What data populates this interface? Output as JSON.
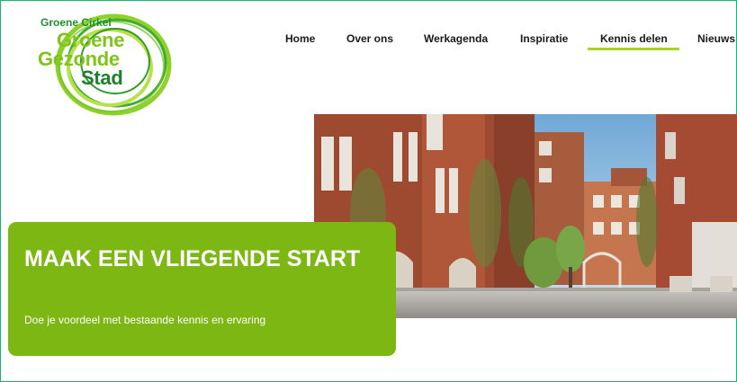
{
  "logo": {
    "top_text": "Groene Cirkel",
    "line1": "Groene",
    "line2": "Gezonde",
    "line3": "Stad"
  },
  "nav": {
    "items": [
      {
        "label": "Home"
      },
      {
        "label": "Over ons"
      },
      {
        "label": "Werkagenda"
      },
      {
        "label": "Inspiratie"
      },
      {
        "label": "Kennis delen",
        "active": true
      },
      {
        "label": "Nieuws"
      }
    ]
  },
  "hero": {
    "title": "MAAK EEN VLIEGENDE START",
    "subtitle": "Doe je voordeel met bestaande kennis en ervaring"
  },
  "colors": {
    "accent": "#7cb713",
    "underline": "#a8d41e",
    "frame": "#16b86a",
    "logo_dark": "#1e7f2a",
    "logo_light": "#7fc41a"
  }
}
